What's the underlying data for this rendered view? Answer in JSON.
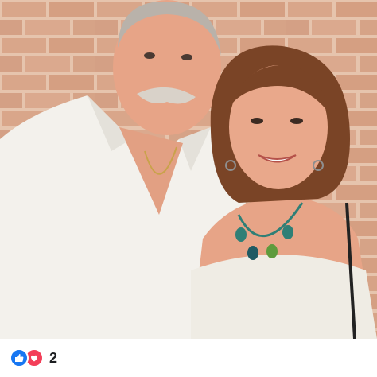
{
  "post": {
    "reactions": {
      "icons": [
        "like-icon",
        "love-icon"
      ],
      "like_color": "#1877f2",
      "love_color": "#f33e58",
      "count": "2"
    }
  },
  "colors": {
    "brick": "#d7a286",
    "mortar": "#e9c9b4",
    "shirt": "#f3f1ec",
    "hair_woman": "#7a4426",
    "hair_man": "#b9b2aa",
    "skin": "#e7a487",
    "necklace": "#2f7f76"
  }
}
